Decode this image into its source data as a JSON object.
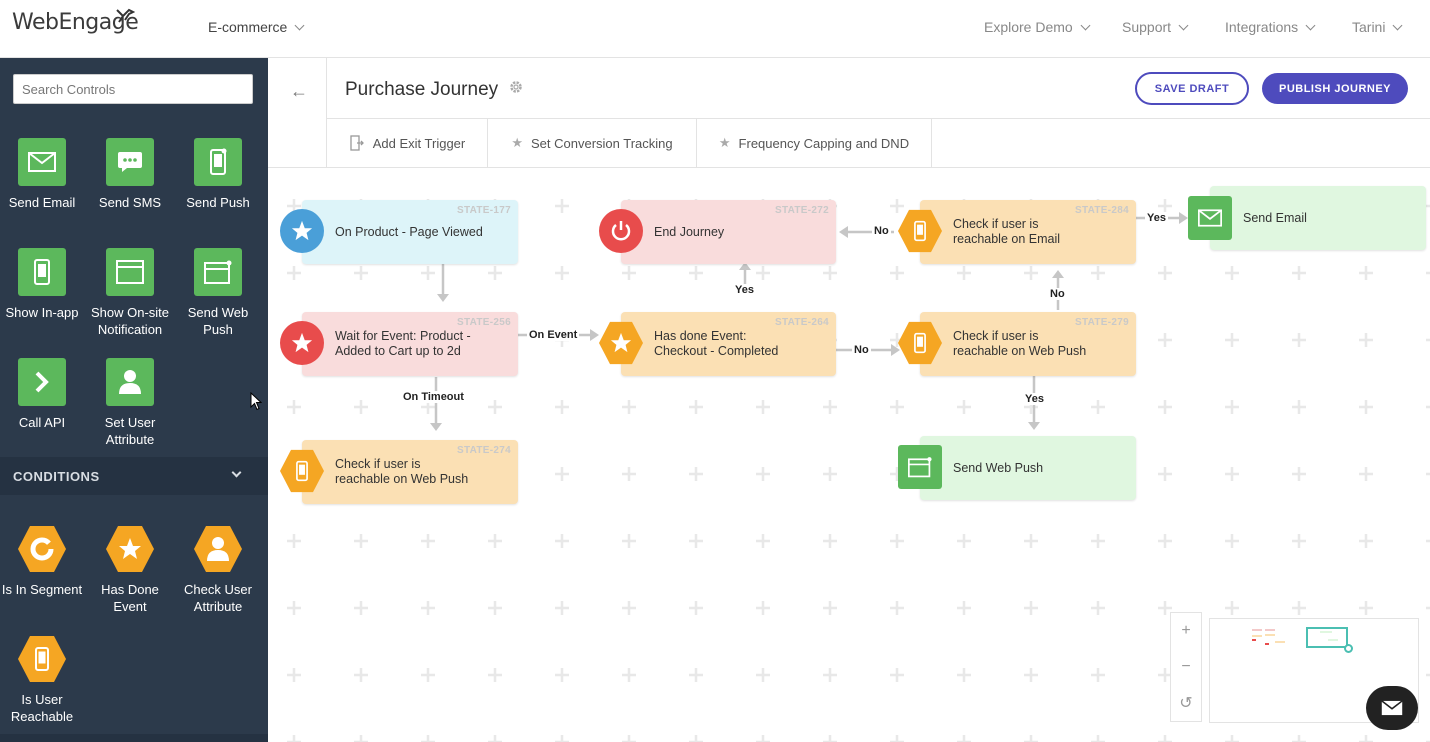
{
  "app": {
    "logo": "WebEngage",
    "project": "E-commerce",
    "nav": [
      "Explore Demo",
      "Support",
      "Integrations",
      "Tarini"
    ]
  },
  "sidebar": {
    "search_placeholder": "Search Controls",
    "channels": [
      {
        "label": "Send Email",
        "icon": "envelope-icon"
      },
      {
        "label": "Send SMS",
        "icon": "sms-bubble-icon"
      },
      {
        "label": "Send Push",
        "icon": "phone-push-icon"
      },
      {
        "label": "Show In-app",
        "icon": "phone-icon"
      },
      {
        "label": "Show On-site Notification",
        "icon": "browser-window-icon"
      },
      {
        "label": "Send Web Push",
        "icon": "browser-push-icon"
      },
      {
        "label": "Call API",
        "icon": "chevron-right-icon"
      },
      {
        "label": "Set User Attribute",
        "icon": "user-icon"
      }
    ],
    "conditions_header": "CONDITIONS",
    "conditions": [
      {
        "label": "Is In Segment",
        "icon": "segment-ring-icon"
      },
      {
        "label": "Has Done Event",
        "icon": "star-icon"
      },
      {
        "label": "Check User Attribute",
        "icon": "user-icon"
      },
      {
        "label": "Is User Reachable",
        "icon": "phone-icon"
      }
    ]
  },
  "header": {
    "title": "Purchase Journey",
    "save_draft": "SAVE DRAFT",
    "publish": "PUBLISH JOURNEY",
    "subbar": [
      "Add Exit Trigger",
      "Set Conversion Tracking",
      "Frequency Capping and DND"
    ]
  },
  "journey": {
    "nodes": {
      "n177": {
        "text": "On Product - Page Viewed",
        "state": "STATE-177"
      },
      "n256": {
        "text": "Wait for Event: Product - Added to Cart up to 2d",
        "state": "STATE-256"
      },
      "n274": {
        "text": "Check if user is reachable on Web Push",
        "state": "STATE-274"
      },
      "n272": {
        "text": "End Journey",
        "state": "STATE-272"
      },
      "n264": {
        "text": "Has done Event: Checkout - Completed",
        "state": "STATE-264"
      },
      "n284": {
        "text": "Check if user is reachable on Email",
        "state": "STATE-284"
      },
      "n279": {
        "text": "Check if user is reachable on Web Push",
        "state": "STATE-279"
      },
      "email": {
        "text": "Send Email"
      },
      "webpush": {
        "text": "Send Web Push"
      }
    },
    "edges": {
      "on_event": "On Event",
      "on_timeout": "On Timeout",
      "yes1": "Yes",
      "no1": "No",
      "no2": "No",
      "no3": "No",
      "yes2": "Yes",
      "yes3": "Yes"
    }
  },
  "zoom": {
    "plus": "+",
    "minus": "−",
    "reset": "↺"
  },
  "colors": {
    "accent": "#4e4bbd",
    "sidebar": "#2c3a4b",
    "action_green": "#5cb85c",
    "condition_orange": "#f5a623",
    "trigger_blue": "#4a9fd8",
    "exit_red": "#e84c4c"
  }
}
